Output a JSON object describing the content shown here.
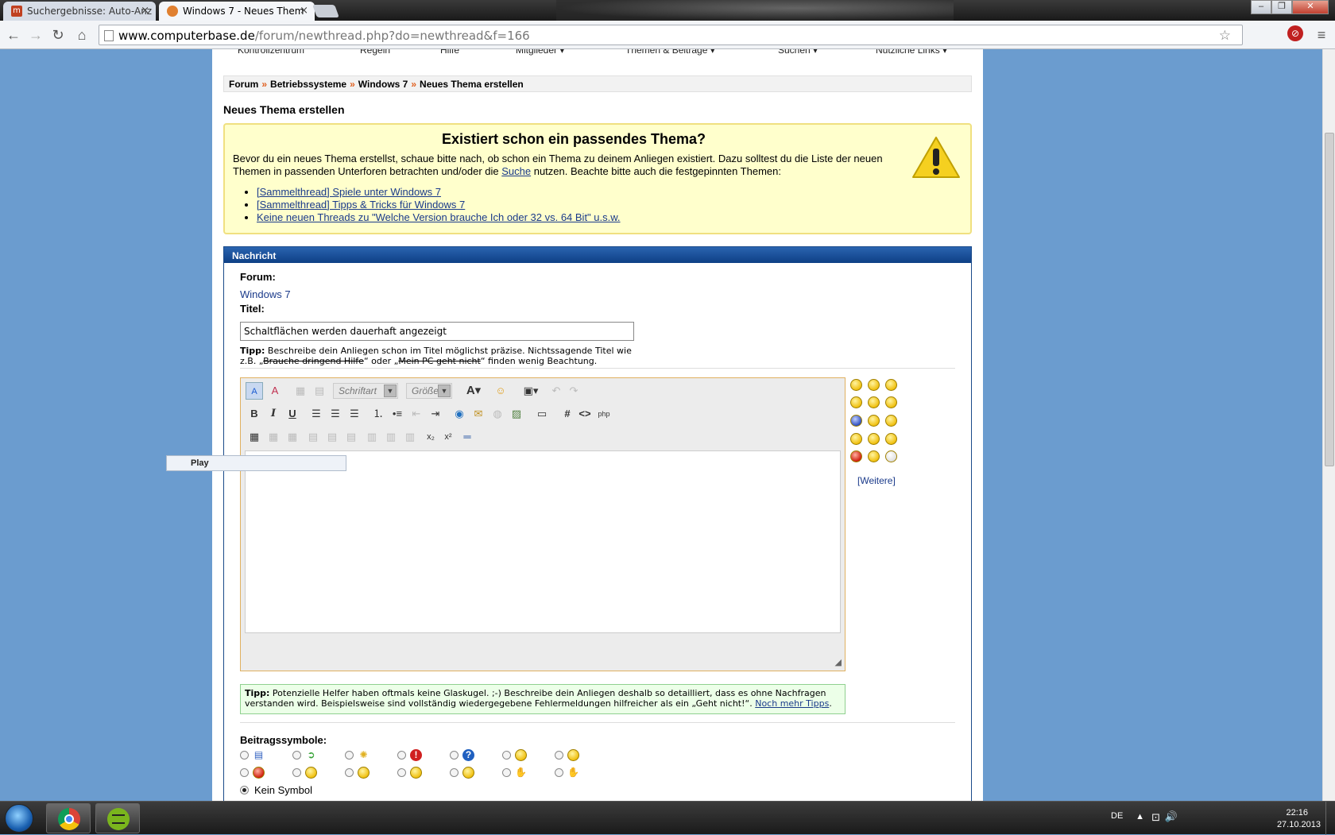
{
  "browser": {
    "tabs": [
      {
        "title": "Suchergebnisse: Auto-Anz",
        "favicon": "m",
        "close": "×"
      },
      {
        "title": "Windows 7 - Neues Them",
        "close": "×"
      }
    ],
    "url_domain": "www.computerbase.de",
    "url_path": "/forum/newthread.php?do=newthread&f=166",
    "window_buttons": [
      "–",
      "❐",
      "✕"
    ]
  },
  "topnav": {
    "items": [
      "Kontrollzentrum",
      "Regeln",
      "Hilfe",
      "Mitglieder ▾",
      "Themen & Beiträge ▾",
      "Suchen ▾",
      "Nützliche Links ▾"
    ]
  },
  "breadcrumb": {
    "items": [
      "Forum",
      "Betriebssysteme",
      "Windows 7",
      "Neues Thema erstellen"
    ],
    "separator": "»"
  },
  "page_title": "Neues Thema erstellen",
  "notice": {
    "heading": "Existiert schon ein passendes Thema?",
    "text_before": "Bevor du ein neues Thema erstellst, schaue bitte nach, ob schon ein Thema zu deinem Anliegen existiert. Dazu solltest du die Liste der neuen Themen in passenden Unterforen betrachten und/oder die ",
    "link": "Suche",
    "text_after": " nutzen. Beachte bitte auch die festgepinnten Themen:",
    "pinned": [
      "[Sammelthread] Spiele unter Windows 7",
      "[Sammelthread] Tipps & Tricks für Windows 7",
      "Keine neuen Threads zu \"Welche Version brauche Ich oder 32 vs. 64 Bit\" u.s.w."
    ]
  },
  "message": {
    "header": "Nachricht",
    "forum_label": "Forum:",
    "forum_value": "Windows 7",
    "title_label": "Titel:",
    "title_value": "Schaltflächen werden dauerhaft angezeigt",
    "tip1_label": "Tipp:",
    "tip1_a": " Beschreibe dein Anliegen schon im Titel möglichst präzise. Nichtssagende Titel wie z.B. „",
    "tip1_strike1": "Brauche dringend Hilfe",
    "tip1_b": "“ oder „",
    "tip1_strike2": "Mein PC geht nicht",
    "tip1_c": "“ finden wenig Beachtung.",
    "font_select": "Schriftart",
    "size_select": "Größe",
    "more_smilies": "[Weitere]",
    "tip2_label": "Tipp:",
    "tip2_text": " Potenzielle Helfer haben oftmals keine Glaskugel. ;-) Beschreibe dein Anliegen deshalb so detailliert, dass es ohne Nachfragen verstanden wird. Beispielsweise sind vollständig wiedergegebene Fehlermeldungen hilfreicher als ein „Geht nicht!“. ",
    "tip2_link": "Noch mehr Tipps",
    "tip2_end": ".",
    "symbols_label": "Beitragssymbole:",
    "no_symbol": "Kein Symbol"
  },
  "popup": {
    "label": "Play"
  },
  "taskbar": {
    "language": "DE",
    "time": "22:16",
    "date": "27.10.2013"
  }
}
